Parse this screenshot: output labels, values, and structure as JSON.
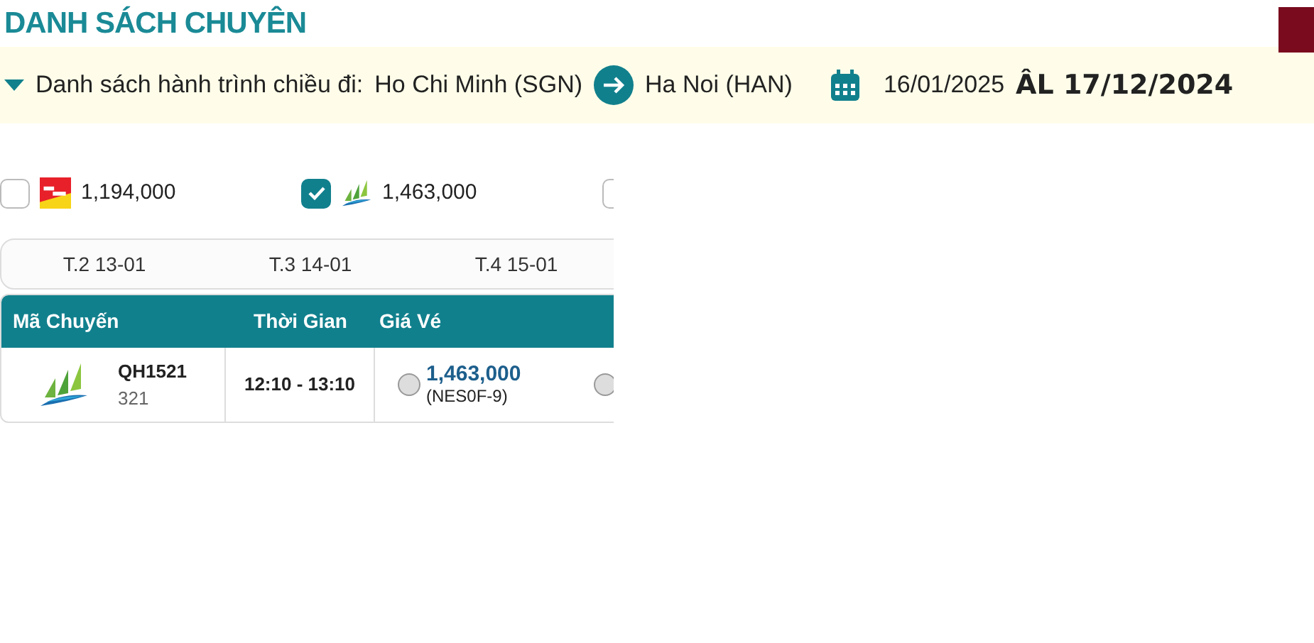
{
  "title": "DANH SÁCH CHUYÊN",
  "route": {
    "label": "Danh sách hành trình chiều đi:",
    "from": "Ho Chi Minh (SGN)",
    "to": "Ha Noi (HAN)",
    "date": "16/01/2025",
    "lunar_date": "ÂL 17/12/2024"
  },
  "airline_filters": [
    {
      "kind": "vietjet",
      "checked": false,
      "price": "1,194,000"
    },
    {
      "kind": "bamboo",
      "checked": true,
      "price": "1,463,000"
    },
    {
      "kind": "none",
      "checked": false
    }
  ],
  "day_tabs": [
    {
      "label": "T.2 13-01",
      "selected": false
    },
    {
      "label": "T.3 14-01",
      "selected": false
    },
    {
      "label": "T.4 15-01",
      "selected": false
    }
  ],
  "table": {
    "columns": [
      "Mã Chuyến",
      "Thời Gian",
      "Giá Vé"
    ],
    "rows": [
      {
        "kind": "bamboo",
        "flight": "QH1521",
        "aircraft": "321",
        "time": "12:10 - 13:10",
        "fares": [
          {
            "price": "1,463,000",
            "code": "(NES0F-9)",
            "selected": false
          },
          {
            "selected": false
          }
        ]
      }
    ]
  }
}
